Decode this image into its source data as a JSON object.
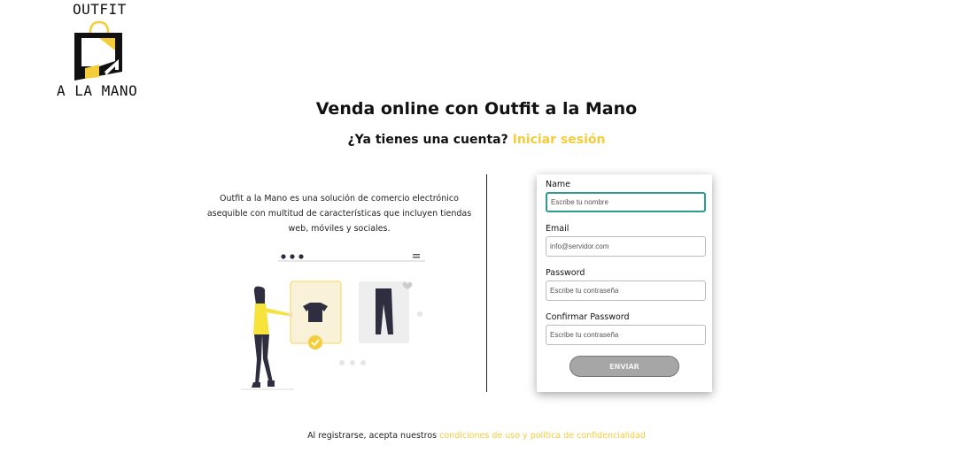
{
  "brand": {
    "logo_top": "OUTFIT",
    "logo_bottom": "A LA MANO"
  },
  "header": {
    "title": "Venda online con Outfit a la Mano",
    "subtitle_text": "¿Ya tienes una cuenta?",
    "login_link": "Iniciar sesión"
  },
  "intro": {
    "description": "Outfit a la Mano es una solución de comercio electrónico asequible con multitud de características que incluyen tiendas web, móviles y sociales."
  },
  "form": {
    "name_label": "Name",
    "name_placeholder": "Escribe tu nombre",
    "email_label": "Email",
    "email_placeholder": "info@servidor.com",
    "password_label": "Password",
    "password_placeholder": "Escribe tu contraseña",
    "confirm_label": "Confirmar Password",
    "confirm_placeholder": "Escribe tu contraseña",
    "submit_label": "ENVIAR"
  },
  "footer": {
    "text": "Al registrarse, acepta nuestros",
    "link": "condiciones de uso y política de confidencialidad"
  },
  "colors": {
    "accent": "#f5cc3a",
    "focus": "#2a9d8f",
    "button": "#a6a6a6"
  },
  "icons": [
    "shopping-bag-logo-icon",
    "dots-icon",
    "menu-icon",
    "heart-icon",
    "check-icon"
  ]
}
